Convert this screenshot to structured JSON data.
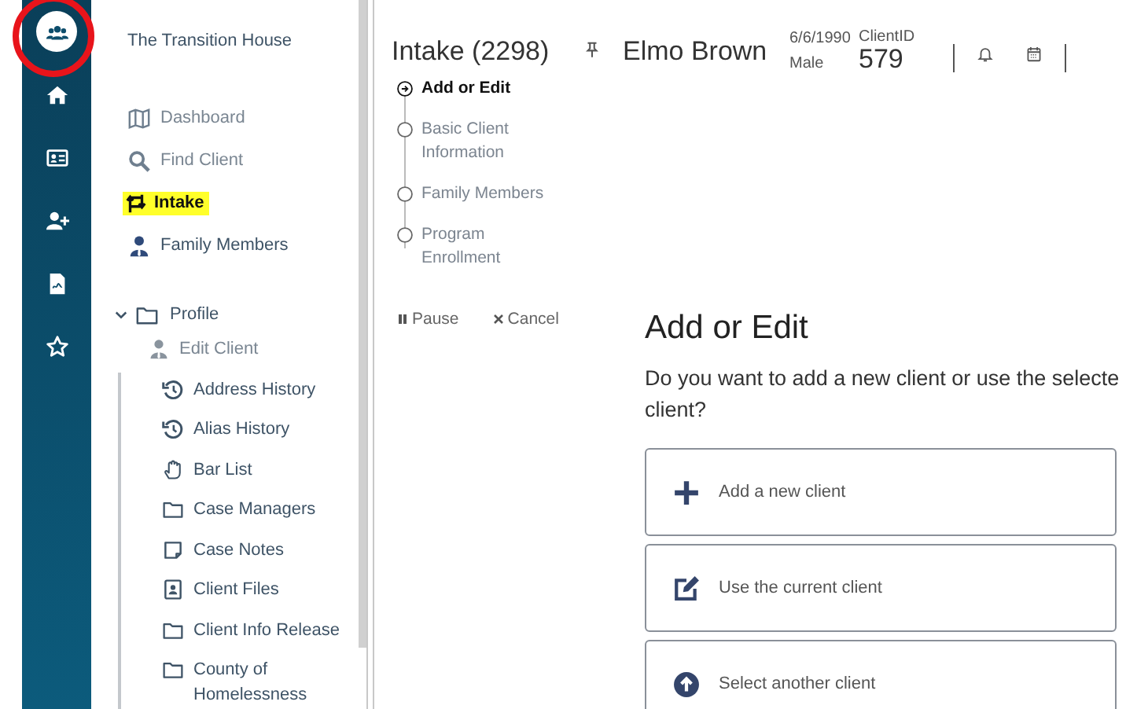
{
  "rail": {
    "circle_annotation": true,
    "items": [
      {
        "selected": true
      },
      {
        "selected": false
      },
      {
        "selected": false
      },
      {
        "selected": false
      },
      {
        "selected": false
      },
      {
        "selected": false
      }
    ]
  },
  "nav": {
    "org": "The Transition House",
    "items": [
      {
        "label": "Dashboard",
        "highlighted": false
      },
      {
        "label": "Find Client",
        "highlighted": false
      },
      {
        "label": "Intake",
        "highlighted": true
      },
      {
        "label": "Family Members",
        "highlighted": false
      }
    ],
    "tree": {
      "label": "Profile",
      "expanded": true,
      "children": [
        {
          "label": "Edit Client"
        },
        {
          "label": "Address History"
        },
        {
          "label": "Alias History"
        },
        {
          "label": "Bar List"
        },
        {
          "label": "Case Managers"
        },
        {
          "label": "Case Notes"
        },
        {
          "label": "Client Files"
        },
        {
          "label": "Client Info Release"
        },
        {
          "label": "County of Homelessness"
        }
      ]
    }
  },
  "header": {
    "title": "Intake (2298)",
    "client_name": "Elmo Brown",
    "dob": "6/6/1990",
    "gender": "Male",
    "id_label": "ClientID",
    "id_value": "579"
  },
  "steps": [
    {
      "label": "Add or Edit",
      "current": true
    },
    {
      "label": "Basic Client Information",
      "current": false
    },
    {
      "label": "Family Members",
      "current": false
    },
    {
      "label": "Program Enrollment",
      "current": false
    }
  ],
  "actions": [
    "Pause",
    "Cancel"
  ],
  "heading": "Add or Edit",
  "prompt_lines": [
    "Do you want to add a new client or use the selecte",
    "client?"
  ],
  "options": [
    {
      "label": "Add a new client"
    },
    {
      "label": "Use the current client"
    },
    {
      "label": "Select another client"
    }
  ]
}
